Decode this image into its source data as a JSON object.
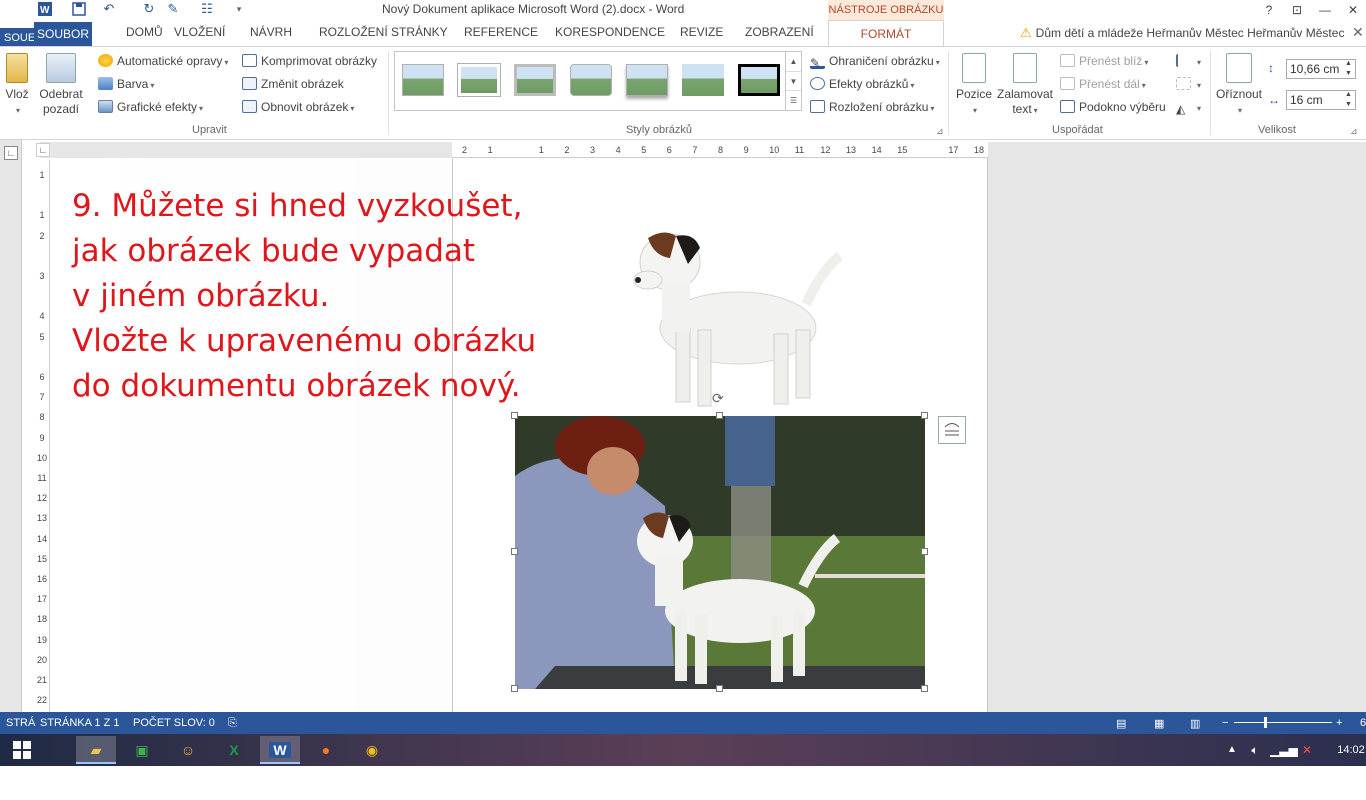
{
  "titlebar": {
    "title": "Nový Dokument aplikace Microsoft Word (2).docx - Word",
    "context_tab_group": "NÁSTROJE OBRÁZKU",
    "help": "?",
    "ribbon_display": "⊡",
    "minimize": "—",
    "close": "✕"
  },
  "tabs": {
    "file_partial": "SOUE",
    "file": "SOUBOR",
    "home": "DOMŮ",
    "insert": "VLOŽENÍ",
    "design": "NÁVRH",
    "layout": "ROZLOŽENÍ STRÁNKY",
    "references": "REFERENCE",
    "mailings": "KORESPONDENCE",
    "review": "REVIZE",
    "view": "ZOBRAZENÍ",
    "format": "FORMÁT"
  },
  "account": {
    "name": "Dům dětí a mládeže Heřmanův Městec Heřmanův Městec"
  },
  "ribbon": {
    "insert_partial": "Vlož",
    "remove_background_1": "Odebrat",
    "remove_background_2": "pozadí",
    "corrections": "Automatické opravy",
    "color": "Barva",
    "artistic_effects": "Grafické efekty",
    "compress": "Komprimovat obrázky",
    "change_picture": "Změnit obrázek",
    "reset_picture": "Obnovit obrázek",
    "group_adjust": "Upravit",
    "group_styles": "Styly obrázků",
    "picture_border": "Ohraničení obrázku",
    "picture_effects": "Efekty obrázků",
    "picture_layout": "Rozložení obrázku",
    "position": "Pozice",
    "wrap_text_1": "Zalamovat",
    "wrap_text_2": "text",
    "bring_forward": "Přenést blíž",
    "send_backward": "Přenést dál",
    "selection_pane": "Podokno výběru",
    "group_arrange": "Uspořádat",
    "crop": "Oříznout",
    "height": "10,66 cm",
    "width": "16 cm",
    "group_size": "Velikost"
  },
  "rulers": {
    "horizontal": [
      "2",
      "1",
      "",
      "1",
      "2",
      "3",
      "4",
      "5",
      "6",
      "7",
      "8",
      "9",
      "10",
      "11",
      "12",
      "13",
      "14",
      "15",
      "",
      "17",
      "18"
    ],
    "vertical": [
      "1",
      "",
      "1",
      "2",
      "",
      "3",
      "",
      "4",
      "5",
      "",
      "6",
      "7",
      "8",
      "9",
      "10",
      "11",
      "12",
      "13",
      "14",
      "15",
      "16",
      "17",
      "18",
      "19",
      "20",
      "21",
      "22"
    ]
  },
  "document": {
    "line1": "9. Můžete si hned vyzkoušet,",
    "line2": "jak obrázek bude vypadat",
    "line3": "v jiném obrázku.",
    "line4": "Vložte k upravenému obrázku",
    "line5": "do dokumentu obrázek nový."
  },
  "statusbar": {
    "partial": "STRÁ",
    "page": "STRÁNKA 1 Z 1",
    "words": "POČET SLOV: 0",
    "zoom_partial": "6"
  },
  "taskbar": {
    "time_partial": "14:02"
  },
  "colors": {
    "word_blue": "#2b579a",
    "instruction_red": "#e0161b",
    "context_orange": "#b5472b"
  }
}
